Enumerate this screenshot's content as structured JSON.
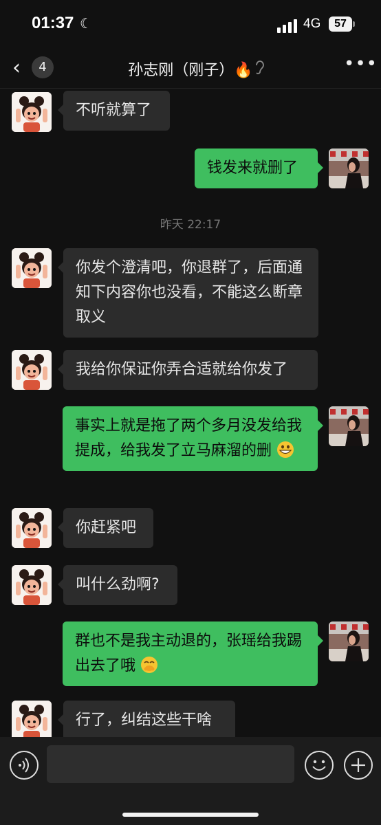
{
  "status": {
    "time": "01:37",
    "network": "4G",
    "battery": "57"
  },
  "nav": {
    "back_count": "4",
    "title": "孙志刚（刚子）🔥"
  },
  "messages": {
    "m1": "不听就算了",
    "m2": "钱发来就删了",
    "ts1": "昨天 22:17",
    "m3": "你发个澄清吧，你退群了，后面通知下内容你也没看，不能这么断章取义",
    "m4": "我给你保证你弄合适就给你发了",
    "m5": "事实上就是拖了两个多月没发给我提成，给我发了立马麻溜的删",
    "m6": "你赶紧吧",
    "m7": "叫什么劲啊?",
    "m8": "群也不是我主动退的，张瑶给我踢出去了哦",
    "m9": "行了，纠结这些干啥"
  },
  "colors": {
    "incoming": "#2c2c2c",
    "outgoing": "#3fbe5f",
    "background": "#111111"
  },
  "icons": [
    "moon-icon",
    "signal-icon",
    "back-icon",
    "ear-icon",
    "more-icon",
    "voice-icon",
    "emoji-icon",
    "plus-icon"
  ]
}
